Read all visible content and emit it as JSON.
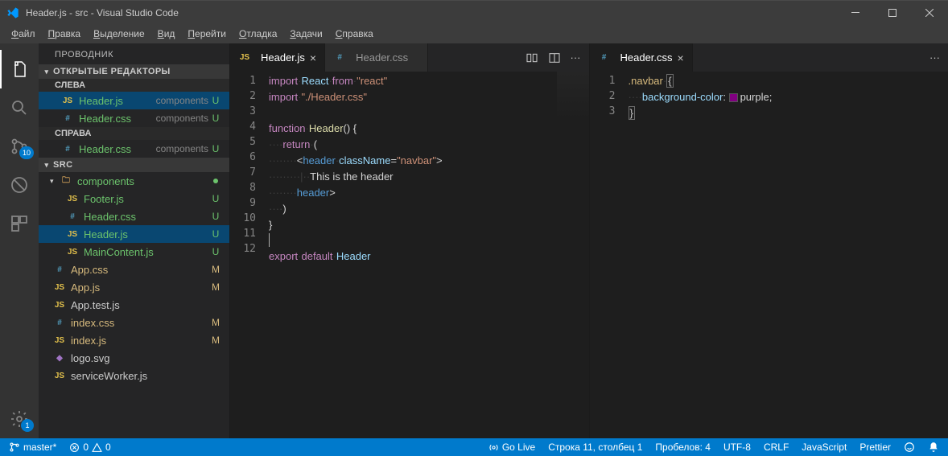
{
  "window": {
    "title": "Header.js - src - Visual Studio Code"
  },
  "menubar": [
    "Файл",
    "Правка",
    "Выделение",
    "Вид",
    "Перейти",
    "Отладка",
    "Задачи",
    "Справка"
  ],
  "activitybar": {
    "scm_badge": "10",
    "settings_badge": "1"
  },
  "explorer": {
    "title": "ПРОВОДНИК",
    "open_editors_label": "ОТКРЫТЫЕ РЕДАКТОРЫ",
    "left_label": "СЛЕВА",
    "right_label": "СПРАВА",
    "open_left": [
      {
        "icon": "js",
        "name": "Header.js",
        "hint": "components",
        "git": "U",
        "selected": true
      },
      {
        "icon": "css",
        "name": "Header.css",
        "hint": "components",
        "git": "U"
      }
    ],
    "open_right": [
      {
        "icon": "css",
        "name": "Header.css",
        "hint": "components",
        "git": "U"
      }
    ],
    "workspace_label": "SRC",
    "tree": [
      {
        "type": "folder",
        "name": "components",
        "modified": true,
        "items": [
          {
            "icon": "js",
            "name": "Footer.js",
            "git": "U"
          },
          {
            "icon": "css",
            "name": "Header.css",
            "git": "U"
          },
          {
            "icon": "js",
            "name": "Header.js",
            "git": "U",
            "selected": true
          },
          {
            "icon": "js",
            "name": "MainContent.js",
            "git": "U"
          }
        ]
      },
      {
        "icon": "css",
        "name": "App.css",
        "git": "M"
      },
      {
        "icon": "js",
        "name": "App.js",
        "git": "M"
      },
      {
        "icon": "js",
        "name": "App.test.js"
      },
      {
        "icon": "css",
        "name": "index.css",
        "git": "M"
      },
      {
        "icon": "js",
        "name": "index.js",
        "git": "M"
      },
      {
        "icon": "svg",
        "name": "logo.svg"
      },
      {
        "icon": "js",
        "name": "serviceWorker.js"
      }
    ]
  },
  "editor_left": {
    "tabs": [
      {
        "icon": "js",
        "name": "Header.js",
        "active": true,
        "dirty": false
      },
      {
        "icon": "css",
        "name": "Header.css",
        "active": false
      }
    ],
    "lines": [
      {
        "n": 1,
        "tokens": [
          [
            "k-keyword",
            "import"
          ],
          [
            "k-punc",
            "·"
          ],
          [
            "k-var",
            "React"
          ],
          [
            "k-punc",
            "·"
          ],
          [
            "k-keyword",
            "from"
          ],
          [
            "k-punc",
            "·"
          ],
          [
            "k-string",
            "\"react\""
          ]
        ]
      },
      {
        "n": 2,
        "tokens": [
          [
            "k-keyword",
            "import"
          ],
          [
            "k-punc",
            "·"
          ],
          [
            "k-string",
            "\"./Header.css\""
          ]
        ]
      },
      {
        "n": 3,
        "tokens": []
      },
      {
        "n": 4,
        "tokens": [
          [
            "k-keyword",
            "function"
          ],
          [
            "k-punc",
            "·"
          ],
          [
            "k-func",
            "Header"
          ],
          [
            "k-punc",
            "() {"
          ]
        ]
      },
      {
        "n": 5,
        "tokens": [
          [
            "k-whitespace",
            "····"
          ],
          [
            "k-keyword",
            "return"
          ],
          [
            "k-punc",
            "·("
          ]
        ]
      },
      {
        "n": 6,
        "tokens": [
          [
            "k-whitespace",
            "········"
          ],
          [
            "k-punc",
            "<"
          ],
          [
            "k-tag",
            "header"
          ],
          [
            "k-punc",
            "·"
          ],
          [
            "k-attr",
            "className"
          ],
          [
            "k-punc",
            "="
          ],
          [
            "k-string",
            "\"navbar\""
          ],
          [
            "k-punc",
            ">"
          ]
        ]
      },
      {
        "n": 7,
        "tokens": [
          [
            "k-whitespace",
            "········"
          ],
          [
            "k-whitespace",
            "·|··"
          ],
          [
            "k-punc",
            "This is the header"
          ]
        ]
      },
      {
        "n": 8,
        "tokens": [
          [
            "k-whitespace",
            "········"
          ],
          [
            "k-punc",
            "</"
          ],
          [
            "k-tag",
            "header"
          ],
          [
            "k-punc",
            ">"
          ]
        ]
      },
      {
        "n": 9,
        "tokens": [
          [
            "k-whitespace",
            "····"
          ],
          [
            "k-punc",
            ")"
          ]
        ]
      },
      {
        "n": 10,
        "tokens": [
          [
            "k-punc",
            "}"
          ]
        ]
      },
      {
        "n": 11,
        "tokens": [
          [
            "cursor",
            ""
          ]
        ]
      },
      {
        "n": 12,
        "tokens": [
          [
            "k-keyword",
            "export"
          ],
          [
            "k-punc",
            "·"
          ],
          [
            "k-keyword",
            "default"
          ],
          [
            "k-punc",
            "·"
          ],
          [
            "k-var",
            "Header"
          ]
        ]
      }
    ]
  },
  "editor_right": {
    "tabs": [
      {
        "icon": "css",
        "name": "Header.css",
        "active": true
      }
    ],
    "lines": [
      {
        "n": 1,
        "tokens": [
          [
            "k-sel",
            ".navbar"
          ],
          [
            "k-punc",
            "·"
          ],
          [
            "k-brace",
            "{"
          ]
        ]
      },
      {
        "n": 2,
        "tokens": [
          [
            "k-whitespace",
            "····"
          ],
          [
            "k-prop",
            "background-color"
          ],
          [
            "k-punc",
            ": "
          ],
          [
            "color",
            "#800080"
          ],
          [
            "k-punc",
            "purple;"
          ]
        ]
      },
      {
        "n": 3,
        "tokens": [
          [
            "k-brace",
            "}"
          ]
        ]
      }
    ]
  },
  "statusbar": {
    "branch": "master*",
    "errors": "0",
    "warnings": "0",
    "golive": "Go Live",
    "cursor": "Строка 11, столбец 1",
    "indent": "Пробелов: 4",
    "encoding": "UTF-8",
    "eol": "CRLF",
    "language": "JavaScript",
    "prettier": "Prettier"
  }
}
